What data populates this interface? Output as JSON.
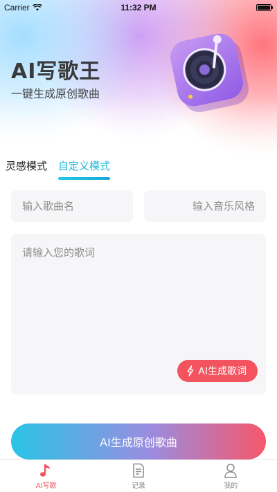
{
  "status_bar": {
    "carrier": "Carrier",
    "time": "11:32 PM"
  },
  "header": {
    "title": "AI写歌王",
    "subtitle": "一键生成原创歌曲"
  },
  "mode_tabs": [
    {
      "label": "灵感模式",
      "active": false
    },
    {
      "label": "自定义模式",
      "active": true
    }
  ],
  "form": {
    "song_name_placeholder": "输入歌曲名",
    "music_style_placeholder": "输入音乐风格",
    "lyrics_placeholder": "请输入您的歌词",
    "ai_lyrics_button": "AI生成歌词"
  },
  "main_button": "AI生成原创歌曲",
  "tabbar": [
    {
      "label": "AI写歌",
      "icon": "music-note-icon",
      "active": true
    },
    {
      "label": "记录",
      "icon": "document-icon",
      "active": false
    },
    {
      "label": "我的",
      "icon": "person-icon",
      "active": false
    }
  ],
  "colors": {
    "accent_cyan": "#1fb8d8",
    "accent_red": "#f2535e"
  }
}
